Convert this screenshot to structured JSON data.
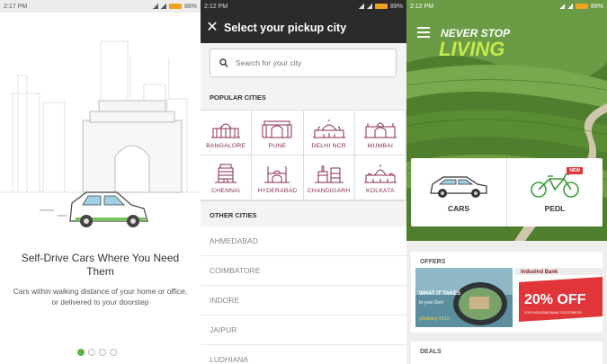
{
  "colors": {
    "accent_green": "#62b14a",
    "city_icon": "#8a2b4d",
    "dark_bar": "#2b2b2b",
    "offer_red": "#e0363a",
    "tagline_green": "#c5e84a"
  },
  "screen1": {
    "status_time": "2:17 PM",
    "status_battery": "88%",
    "title": "Self-Drive Cars Where You Need Them",
    "description": "Cars within walking distance of your home or office, or delivered to your doorstep",
    "page_count": 4,
    "active_page": 0
  },
  "screen2": {
    "status_time": "2:12 PM",
    "status_battery": "89%",
    "title": "Select your pickup city",
    "search_placeholder": "Search for your city",
    "popular_heading": "POPULAR CITIES",
    "popular_cities": [
      "BANGALORE",
      "PUNE",
      "DELHI NCR",
      "MUMBAI",
      "CHENNAI",
      "HYDERABAD",
      "CHANDIGARH",
      "KOLKATA"
    ],
    "other_heading": "OTHER CITIES",
    "other_cities": [
      "AHMEDABAD",
      "COIMBATORE",
      "INDORE",
      "JAIPUR",
      "LUDHIANA"
    ]
  },
  "screen3": {
    "status_time": "2:12 PM",
    "status_battery": "89%",
    "tagline_line1": "NEVER STOP",
    "tagline_line2": "LIVING",
    "option_cars": "CARS",
    "option_pedl": "PEDL",
    "new_badge": "NEW",
    "offers_heading": "OFFERS",
    "offer1_text": "WHAT IT TAKES",
    "offer1_subtext": "to your Den!",
    "offer1_code": "yDelivery #X10",
    "offer2_bank": "IndusInd Bank",
    "offer2_big": "20% OFF",
    "offer2_small": "FOR INDUSIND BANK CUSTOMERS",
    "deals_heading": "DEALS"
  }
}
